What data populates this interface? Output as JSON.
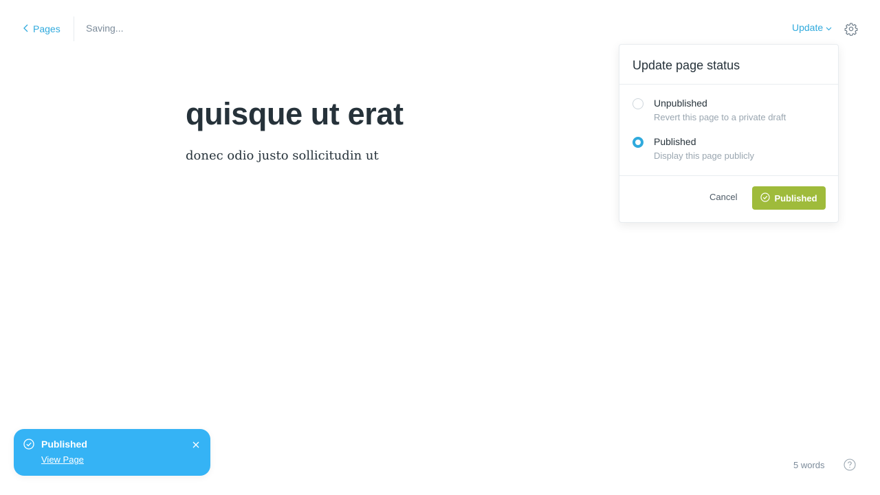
{
  "topbar": {
    "back_label": "Pages",
    "saving_status": "Saving...",
    "update_label": "Update"
  },
  "editor": {
    "title": "quisque ut erat",
    "body": "donec odio justo sollicitudin ut"
  },
  "status_popover": {
    "title": "Update page status",
    "options": [
      {
        "label": "Unpublished",
        "description": "Revert this page to a private draft",
        "selected": false
      },
      {
        "label": "Published",
        "description": "Display this page publicly",
        "selected": true
      }
    ],
    "cancel_label": "Cancel",
    "confirm_label": "Published"
  },
  "toast": {
    "title": "Published",
    "link_label": "View Page"
  },
  "footer": {
    "word_count": "5 words"
  },
  "colors": {
    "accent": "#30aadd",
    "publish_green": "#9fbb3b",
    "toast_blue": "#35b3f5"
  },
  "icons": [
    "chevron-left-icon",
    "chevron-down-icon",
    "gear-icon",
    "check-circle-icon",
    "close-icon",
    "help-icon"
  ]
}
